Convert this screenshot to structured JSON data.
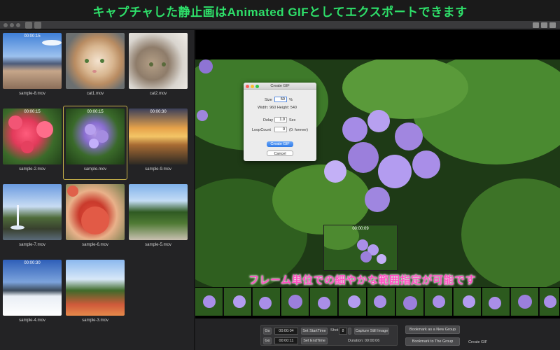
{
  "banner": {
    "text": "キャプチャした静止画はAnimated GIFとしてエクスポートできます"
  },
  "overlay": {
    "text": "フレーム単位での細やかな範囲指定が可能です"
  },
  "library": {
    "items": [
      {
        "name": "sample-8.mov",
        "time": "00:00:15"
      },
      {
        "name": "cat1.mov",
        "time": ""
      },
      {
        "name": "cat2.mov",
        "time": ""
      },
      {
        "name": "sample-2.mov",
        "time": "00:00:15"
      },
      {
        "name": "sample.mov",
        "time": "00:00:15"
      },
      {
        "name": "sample-9.mov",
        "time": "00:00:30"
      },
      {
        "name": "sample-7.mov",
        "time": ""
      },
      {
        "name": "sample-6.mov",
        "time": ""
      },
      {
        "name": "sample-5.mov",
        "time": ""
      },
      {
        "name": "sample-4.mov",
        "time": "00:00:30"
      },
      {
        "name": "sample-3.mov",
        "time": ""
      }
    ]
  },
  "preview": {
    "time": "00:00:09"
  },
  "dialog": {
    "title": "Create GIF",
    "size_label": "Size",
    "size_value": "50",
    "percent": "%",
    "dimensions": "Width: 960   Height: 540",
    "delay_label": "Delay",
    "delay_value": "1.0",
    "delay_unit": "Sec",
    "loop_label": "LoopCount",
    "loop_value": "0",
    "loop_hint": "(0: forever)",
    "create_button": "Create GIF",
    "cancel_button": "Cancel"
  },
  "controls": {
    "go_label": "Go",
    "start_time": "00:00:04",
    "set_start": "Set StartTime",
    "shot_label": "Shot",
    "shot_value": "8",
    "capture": "Capture Still Image",
    "end_time": "00:00:11",
    "set_end": "Set EndTime",
    "duration": "Duration: 00:00:06",
    "bookmark_new": "Bookmark as a New Group",
    "bookmark_to": "Bookmark to The Group",
    "create_gif": "Create GIF"
  }
}
